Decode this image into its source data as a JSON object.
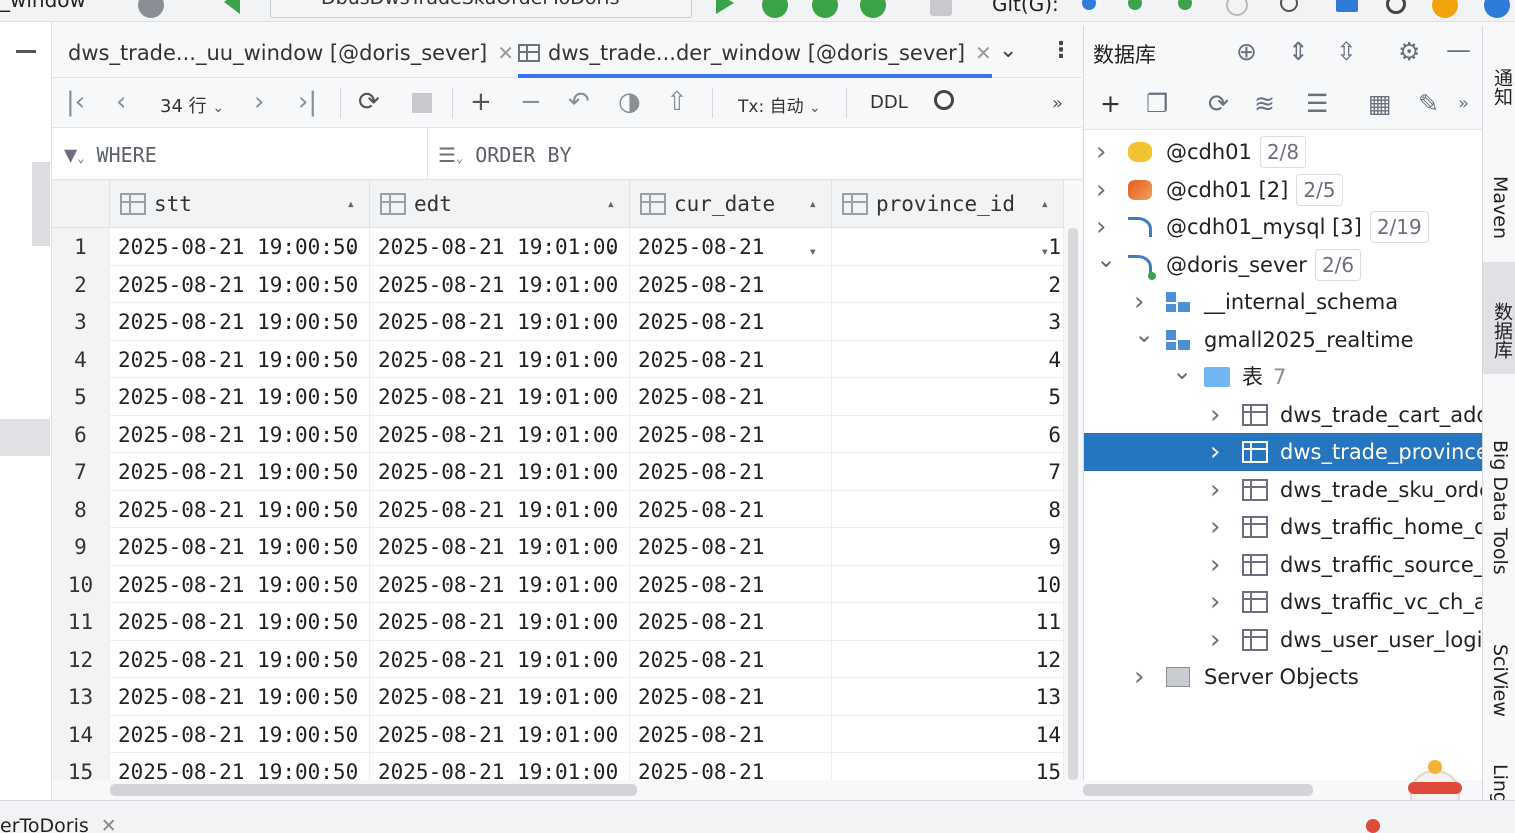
{
  "window": {
    "title_fragment": "_window",
    "run_config": "DbusDwsTradeSkuOrderToDoris",
    "git_label": "Git(G):"
  },
  "tabs": [
    {
      "label": "dws_trade..._uu_window [@doris_sever]",
      "active": false
    },
    {
      "label": "dws_trade...der_window [@doris_sever]",
      "active": true
    }
  ],
  "grid_toolbar": {
    "row_count": "34 行",
    "tx_mode": "Tx: 自动",
    "ddl": "DDL"
  },
  "filter": {
    "where": "WHERE",
    "order_by": "ORDER BY"
  },
  "table": {
    "columns": [
      "stt",
      "edt",
      "cur_date",
      "province_id"
    ],
    "rows": [
      {
        "n": "1",
        "stt": "2025-08-21 19:00:50",
        "edt": "2025-08-21 19:01:00",
        "cur_date": "2025-08-21",
        "province_id": "1"
      },
      {
        "n": "2",
        "stt": "2025-08-21 19:00:50",
        "edt": "2025-08-21 19:01:00",
        "cur_date": "2025-08-21",
        "province_id": "2"
      },
      {
        "n": "3",
        "stt": "2025-08-21 19:00:50",
        "edt": "2025-08-21 19:01:00",
        "cur_date": "2025-08-21",
        "province_id": "3"
      },
      {
        "n": "4",
        "stt": "2025-08-21 19:00:50",
        "edt": "2025-08-21 19:01:00",
        "cur_date": "2025-08-21",
        "province_id": "4"
      },
      {
        "n": "5",
        "stt": "2025-08-21 19:00:50",
        "edt": "2025-08-21 19:01:00",
        "cur_date": "2025-08-21",
        "province_id": "5"
      },
      {
        "n": "6",
        "stt": "2025-08-21 19:00:50",
        "edt": "2025-08-21 19:01:00",
        "cur_date": "2025-08-21",
        "province_id": "6"
      },
      {
        "n": "7",
        "stt": "2025-08-21 19:00:50",
        "edt": "2025-08-21 19:01:00",
        "cur_date": "2025-08-21",
        "province_id": "7"
      },
      {
        "n": "8",
        "stt": "2025-08-21 19:00:50",
        "edt": "2025-08-21 19:01:00",
        "cur_date": "2025-08-21",
        "province_id": "8"
      },
      {
        "n": "9",
        "stt": "2025-08-21 19:00:50",
        "edt": "2025-08-21 19:01:00",
        "cur_date": "2025-08-21",
        "province_id": "9"
      },
      {
        "n": "10",
        "stt": "2025-08-21 19:00:50",
        "edt": "2025-08-21 19:01:00",
        "cur_date": "2025-08-21",
        "province_id": "10"
      },
      {
        "n": "11",
        "stt": "2025-08-21 19:00:50",
        "edt": "2025-08-21 19:01:00",
        "cur_date": "2025-08-21",
        "province_id": "11"
      },
      {
        "n": "12",
        "stt": "2025-08-21 19:00:50",
        "edt": "2025-08-21 19:01:00",
        "cur_date": "2025-08-21",
        "province_id": "12"
      },
      {
        "n": "13",
        "stt": "2025-08-21 19:00:50",
        "edt": "2025-08-21 19:01:00",
        "cur_date": "2025-08-21",
        "province_id": "13"
      },
      {
        "n": "14",
        "stt": "2025-08-21 19:00:50",
        "edt": "2025-08-21 19:01:00",
        "cur_date": "2025-08-21",
        "province_id": "14"
      },
      {
        "n": "15",
        "stt": "2025-08-21 19:00:50",
        "edt": "2025-08-21 19:01:00",
        "cur_date": "2025-08-21",
        "province_id": "15"
      }
    ]
  },
  "db_panel": {
    "title": "数据库",
    "tree": [
      {
        "label": "@cdh01",
        "badge": "2/8",
        "level": 0,
        "expanded": false,
        "icon": "hive-icon"
      },
      {
        "label": "@cdh01 [2]",
        "badge": "2/5",
        "level": 0,
        "expanded": false,
        "icon": "spark-icon"
      },
      {
        "label": "@cdh01_mysql [3]",
        "badge": "2/19",
        "level": 0,
        "expanded": false,
        "icon": "mysql-icon"
      },
      {
        "label": "@doris_sever",
        "badge": "2/6",
        "level": 0,
        "expanded": true,
        "icon": "mysql-connected-icon"
      },
      {
        "label": "__internal_schema",
        "badge": "",
        "level": 1,
        "expanded": false,
        "icon": "schema-icon"
      },
      {
        "label": "gmall2025_realtime",
        "badge": "",
        "level": 1,
        "expanded": true,
        "icon": "schema-icon"
      },
      {
        "label": "表",
        "count": "7",
        "badge": "",
        "level": 2,
        "expanded": true,
        "icon": "folder-icon"
      },
      {
        "label": "dws_trade_cart_add_",
        "badge": "",
        "level": 3,
        "expanded": false,
        "icon": "table-icon"
      },
      {
        "label": "dws_trade_province_",
        "badge": "",
        "level": 3,
        "expanded": false,
        "icon": "table-icon",
        "selected": true
      },
      {
        "label": "dws_trade_sku_orde",
        "badge": "",
        "level": 3,
        "expanded": false,
        "icon": "table-icon"
      },
      {
        "label": "dws_traffic_home_de",
        "badge": "",
        "level": 3,
        "expanded": false,
        "icon": "table-icon"
      },
      {
        "label": "dws_traffic_source_k",
        "badge": "",
        "level": 3,
        "expanded": false,
        "icon": "table-icon"
      },
      {
        "label": "dws_traffic_vc_ch_ar",
        "badge": "",
        "level": 3,
        "expanded": false,
        "icon": "table-icon"
      },
      {
        "label": "dws_user_user_login",
        "badge": "",
        "level": 3,
        "expanded": false,
        "icon": "table-icon"
      },
      {
        "label": "Server Objects",
        "badge": "",
        "level": 1,
        "expanded": false,
        "icon": "server-objects-icon"
      }
    ]
  },
  "right_strip": {
    "notifications": "通知",
    "maven": "Maven",
    "database": "数据库",
    "big_data_tools": "Big Data Tools",
    "sciview": "SciView",
    "lingma": "Lingma"
  },
  "bottom_bar": {
    "tab_label": "erToDoris"
  },
  "colors": {
    "accent": "#3574f0",
    "selection": "#2675bf",
    "run_green": "#3ca34a"
  }
}
